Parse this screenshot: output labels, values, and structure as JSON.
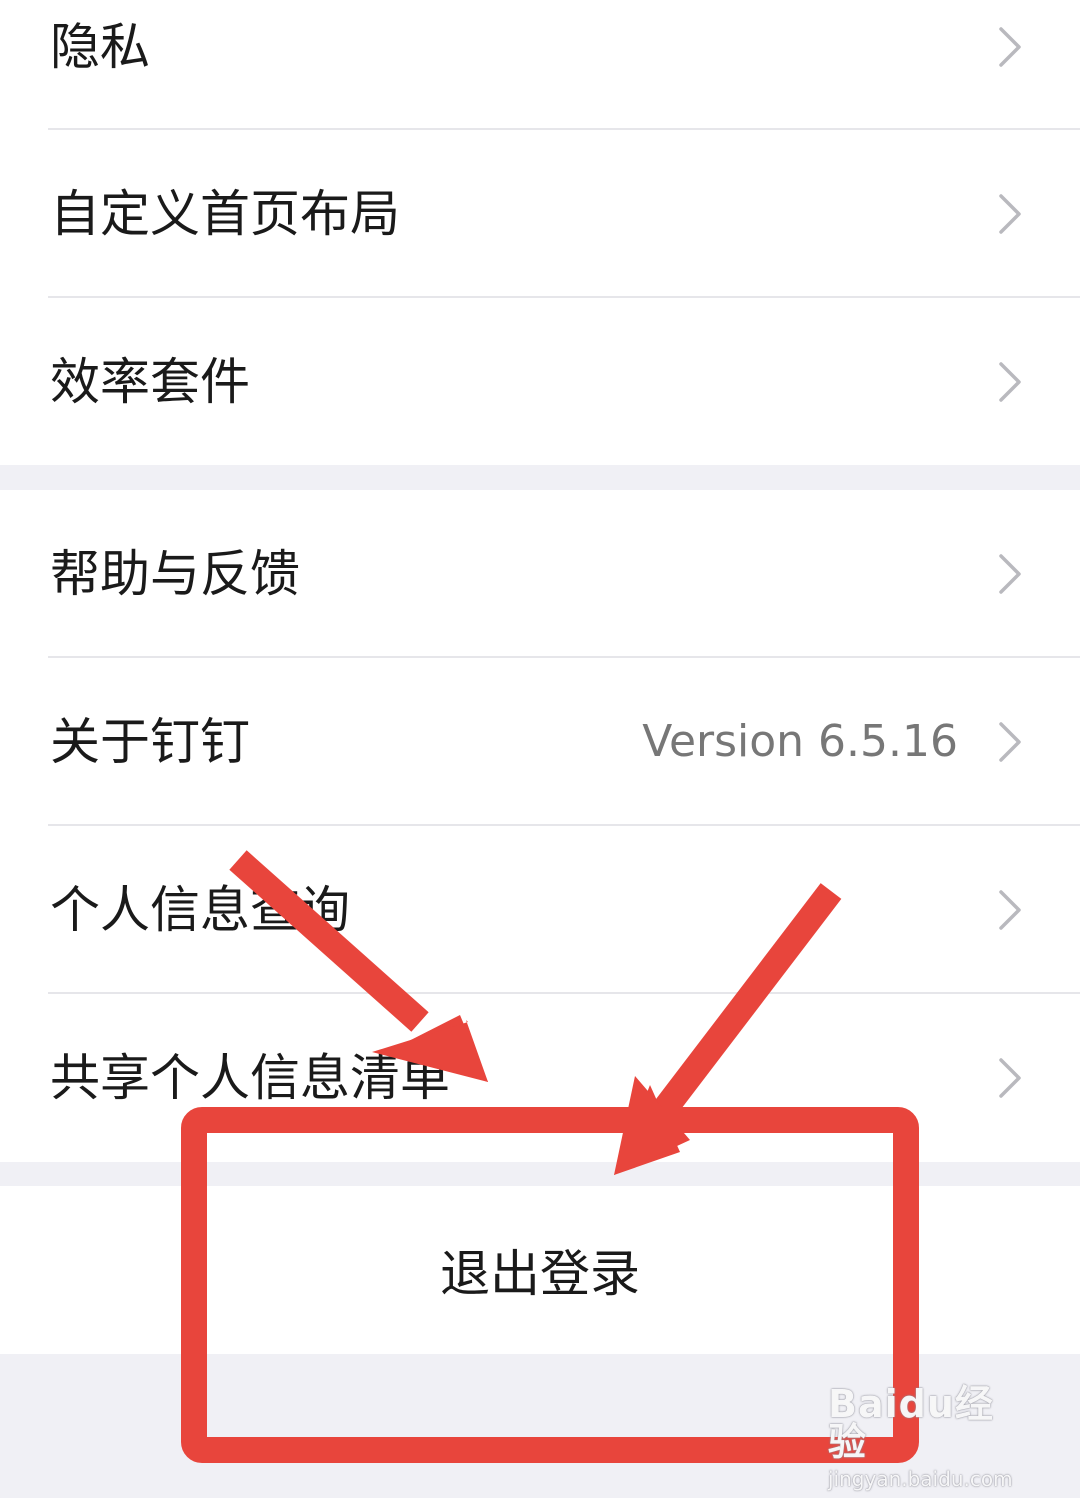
{
  "settings": {
    "group1": [
      {
        "label": "隐私"
      },
      {
        "label": "自定义首页布局"
      },
      {
        "label": "效率套件"
      }
    ],
    "group2": [
      {
        "label": "帮助与反馈"
      },
      {
        "label": "关于钉钉",
        "value": "Version 6.5.16"
      },
      {
        "label": "个人信息查询"
      },
      {
        "label": "共享个人信息清单"
      }
    ],
    "logout_label": "退出登录"
  },
  "icons": {
    "row_chevron": "chevron-right-icon"
  },
  "colors": {
    "background": "#f0f0f5",
    "card": "#ffffff",
    "text": "#1a1a1a",
    "secondary_text": "#777777",
    "annotation_red": "#e8453c"
  },
  "watermark": {
    "brand": "Baidu经验",
    "url": "jingyan.baidu.com"
  }
}
